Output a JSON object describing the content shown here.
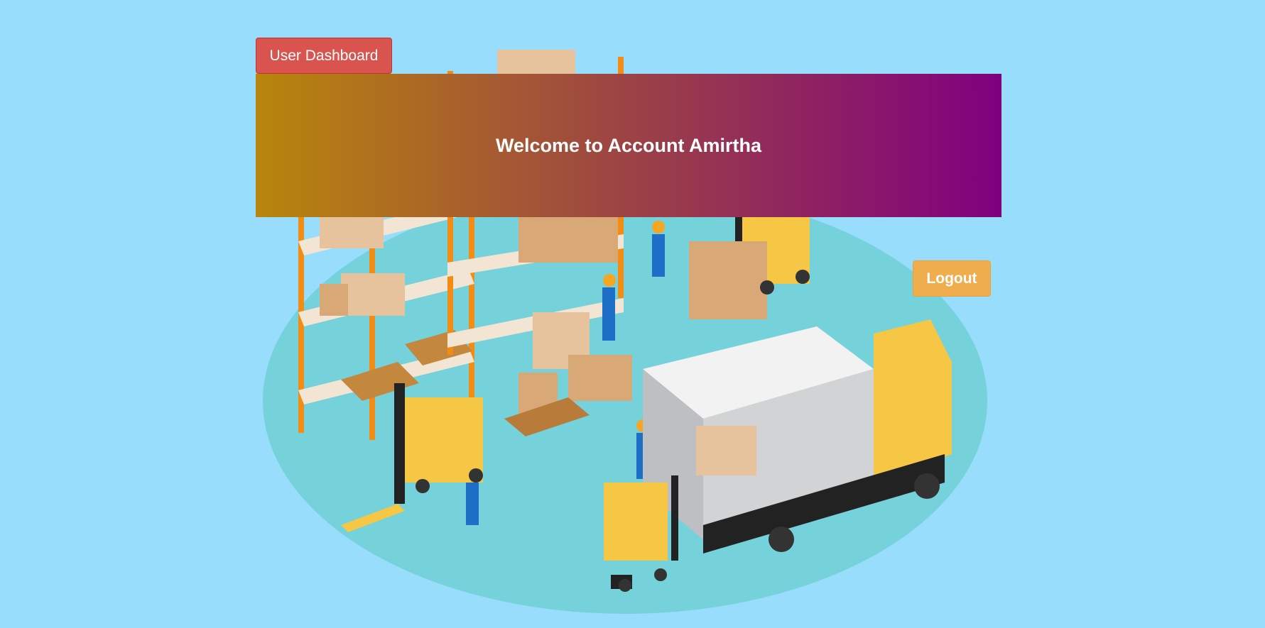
{
  "header": {
    "dashboard_label": "User Dashboard"
  },
  "banner": {
    "welcome_text": "Welcome to Account Amirtha"
  },
  "actions": {
    "logout_label": "Logout"
  },
  "colors": {
    "background": "#99DDFC",
    "dashboard_button": "#D9534F",
    "banner_gradient_start": "#B8860B",
    "banner_gradient_end": "#800080",
    "logout_button": "#F0AD4E",
    "floor_ellipse": "#75D1DA"
  },
  "illustration": {
    "icon": "warehouse-logistics-illustration"
  }
}
